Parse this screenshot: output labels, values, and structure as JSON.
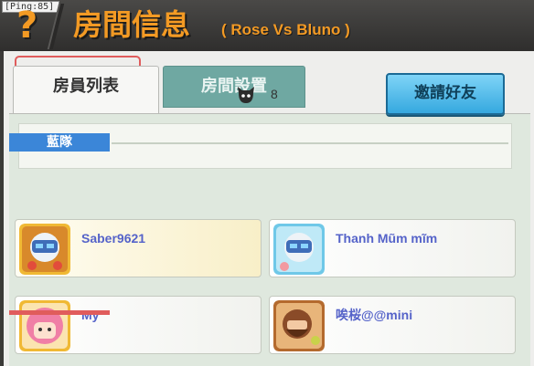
{
  "header": {
    "ping_label": "[Ping:85]",
    "help_glyph": "?",
    "title": "房間信息",
    "subtitle": "( Rose Vs Bluno )"
  },
  "tabs": [
    {
      "label": "房員列表",
      "active": true
    },
    {
      "label": "房間設置",
      "active": false
    }
  ],
  "room": {
    "id": "1000_1",
    "player_count": "8",
    "invite_label": "邀請好友"
  },
  "team": {
    "label": "藍隊",
    "color": "#3b86d8"
  },
  "players": [
    {
      "name": "Saber9621",
      "avatar": "robot-knight-avatar-gold-frame"
    },
    {
      "name": "Thanh Mũm mĩm",
      "avatar": "robot-knight-avatar-blue-frame"
    },
    {
      "name": "My",
      "avatar": "pink-hair-girl-avatar"
    },
    {
      "name": "唉桜@@mini",
      "avatar": "bearded-warrior-avatar"
    }
  ],
  "colors": {
    "accent_orange": "#f39a24",
    "invite_blue": "#35a8df",
    "highlight_red": "#e05c5c",
    "player_name": "#5563c9"
  }
}
